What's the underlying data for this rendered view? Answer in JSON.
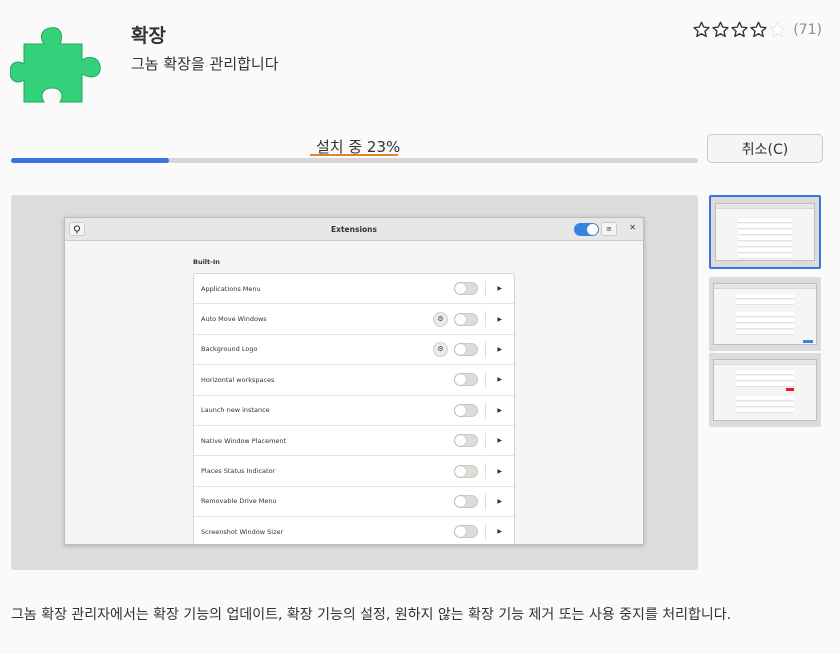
{
  "app": {
    "icon": "puzzle-piece-icon",
    "icon_color": "#33d17a",
    "title": "확장",
    "summary": "그놈 확장을 관리합니다"
  },
  "rating": {
    "stars_filled": 4,
    "stars_total": 5,
    "count_text": "(71)"
  },
  "install": {
    "status_label": "설치 중 23%",
    "progress_fraction": 0.23,
    "cancel_label": "취소(C)",
    "accent_color": "#3b72e0"
  },
  "screenshot": {
    "window_title": "Extensions",
    "section_label": "Built-In",
    "extensions": [
      {
        "name": "Applications Menu",
        "has_settings": false
      },
      {
        "name": "Auto Move Windows",
        "has_settings": true
      },
      {
        "name": "Background Logo",
        "has_settings": true
      },
      {
        "name": "Horizontal workspaces",
        "has_settings": false
      },
      {
        "name": "Launch new instance",
        "has_settings": false
      },
      {
        "name": "Native Window Placement",
        "has_settings": false
      },
      {
        "name": "Places Status Indicator",
        "has_settings": false
      },
      {
        "name": "Removable Drive Menu",
        "has_settings": false
      },
      {
        "name": "Screenshot Window Sizer",
        "has_settings": false
      }
    ]
  },
  "thumbnails": {
    "count": 3,
    "selected_index": 0
  },
  "description": "그놈 확장 관리자에서는 확장 기능의 업데이트, 확장 기능의 설정, 원하지 않는 확장 기능 제거 또는 사용 중지를 처리합니다."
}
